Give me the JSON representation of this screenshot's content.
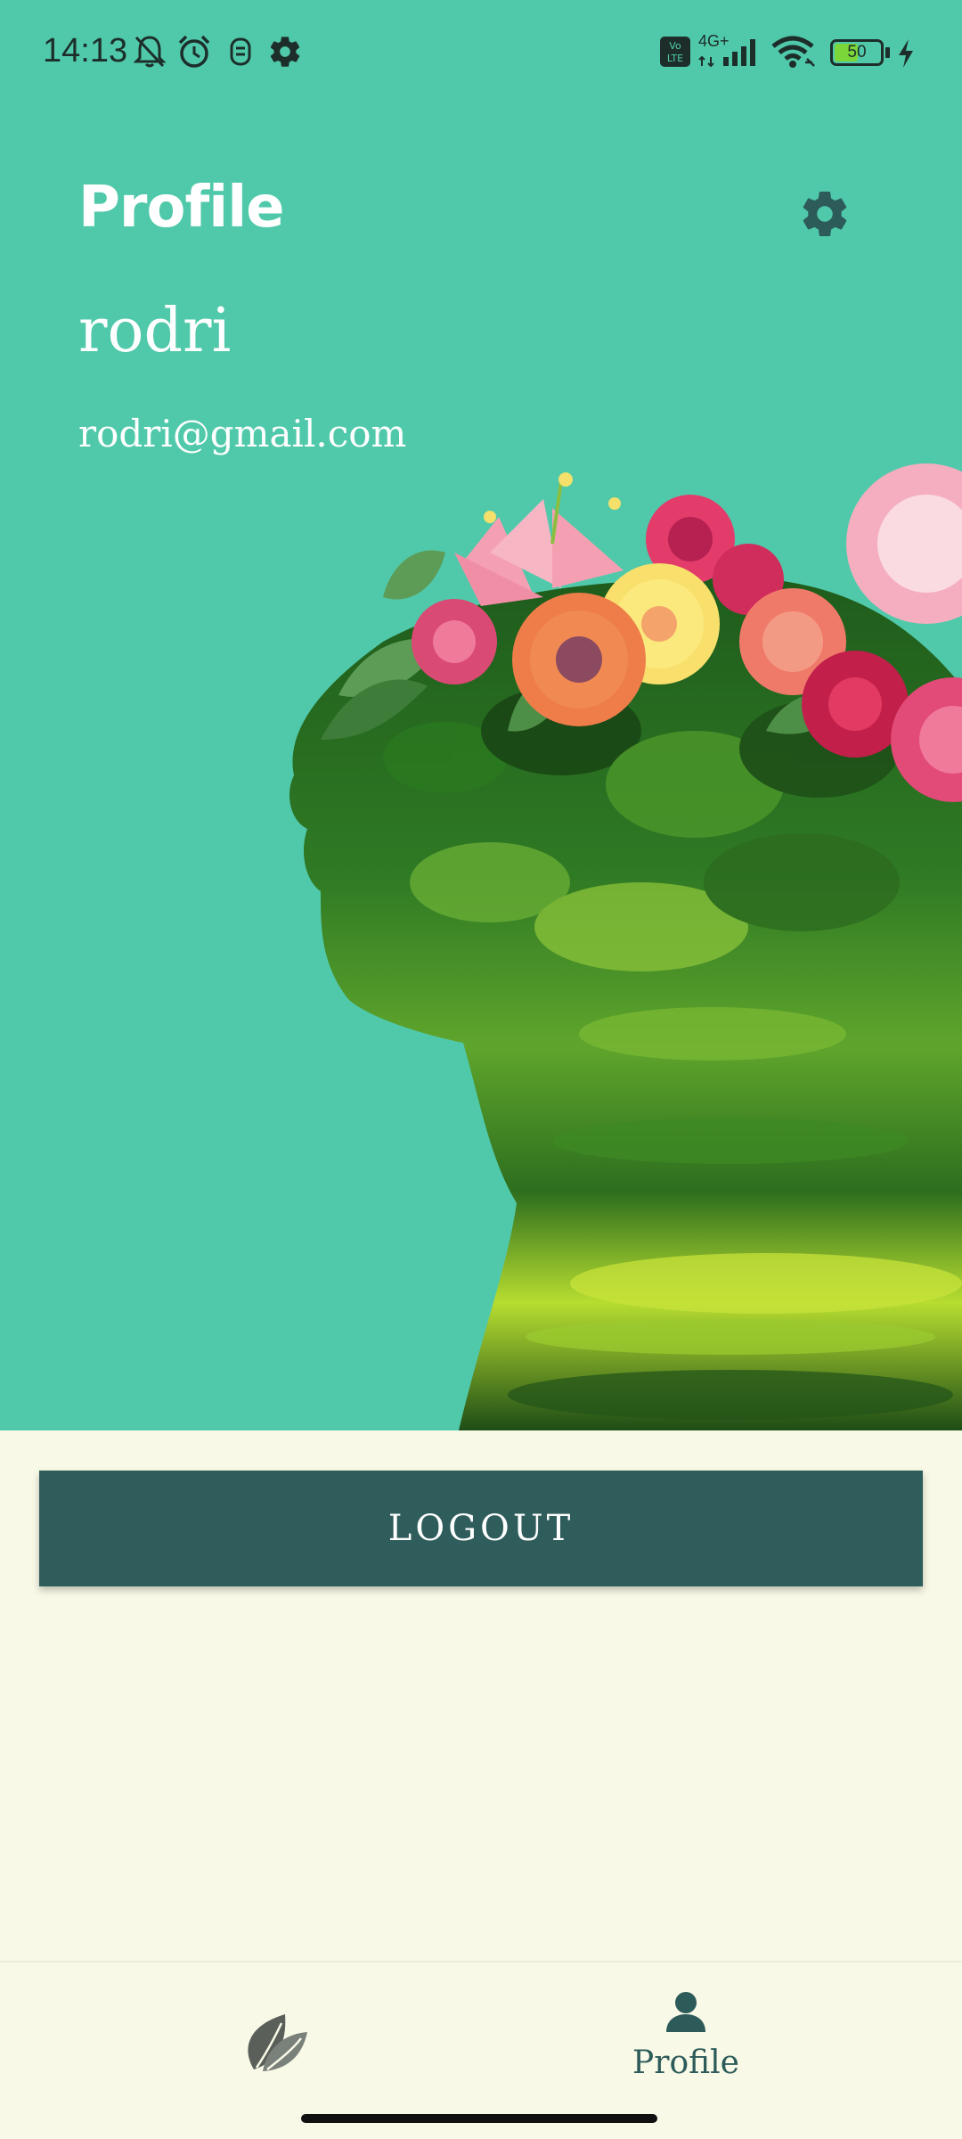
{
  "status_bar": {
    "time": "14:13",
    "battery_level": "50",
    "network_label": "4G+",
    "volte_label": "Vo LTE"
  },
  "header": {
    "title": "Profile"
  },
  "user": {
    "name": "rodri",
    "email": "rodri@gmail.com"
  },
  "actions": {
    "logout_label": "LOGOUT"
  },
  "bottom_nav": {
    "items": [
      {
        "icon": "leaf-icon",
        "label": ""
      },
      {
        "icon": "person-icon",
        "label": "Profile"
      }
    ]
  },
  "colors": {
    "hero_background": "#50c9aa",
    "page_background": "#f8f9e6",
    "button_background": "#2f5d5c",
    "icon_dark": "#2d5b5a"
  }
}
